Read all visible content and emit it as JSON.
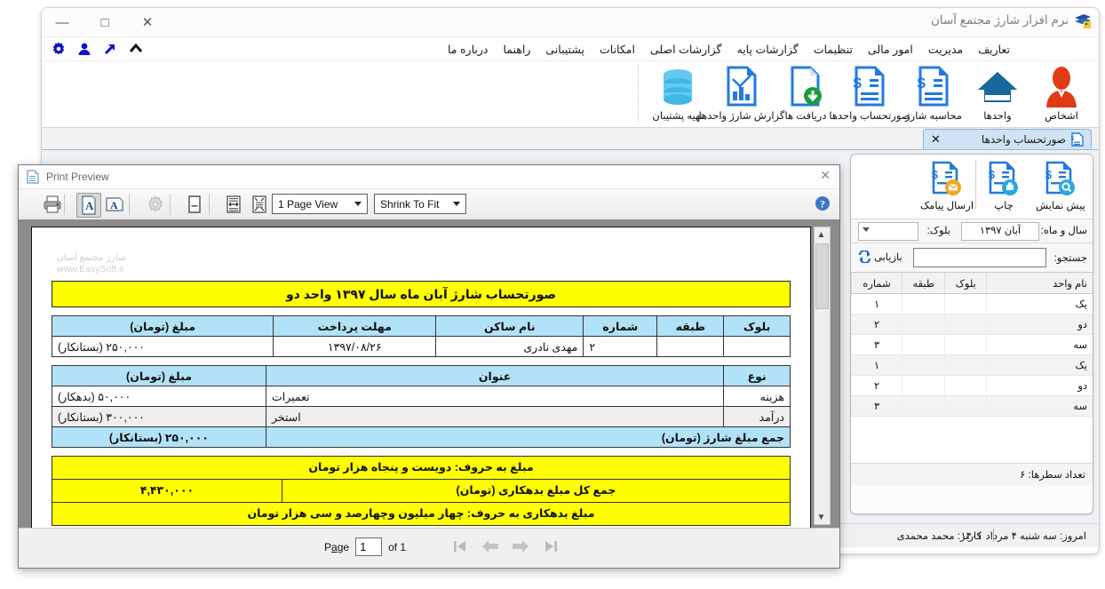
{
  "app": {
    "title": "نرم افزار شارژ مجتمع آسان",
    "window_controls": {
      "close": "✕",
      "maximize": "□",
      "minimize": "—"
    },
    "quick_icons": [
      "chevron-up-icon",
      "arrow-up-right-icon",
      "person-icon",
      "gear-icon"
    ],
    "menu": [
      "تعاریف",
      "مدیریت",
      "امور مالی",
      "تنظیمات",
      "گزارشات پایه",
      "گزارشات اصلی",
      "امکانات",
      "پشتیبانی",
      "راهنما",
      "درباره ما"
    ],
    "ribbon": [
      {
        "label": "اشخاص",
        "icon": "person-red-icon"
      },
      {
        "label": "واحدها",
        "icon": "house-icon"
      },
      {
        "label": "محاسبه شارژ",
        "icon": "invoice-icon"
      },
      {
        "label": "صورتحساب واحدها",
        "icon": "invoice-icon"
      },
      {
        "label": "دریافت ها",
        "icon": "document-download-icon"
      },
      {
        "label": "گزارش شارژ واحدها",
        "icon": "chart-document-icon"
      },
      {
        "label": "تهیه پشتیبان",
        "icon": "database-icon"
      }
    ],
    "tab": {
      "label": "صورتحساب واحدها",
      "close": "✕",
      "icon": "invoice-tab-icon"
    }
  },
  "panel": {
    "actions": [
      {
        "label": "پیش نمایش",
        "icon": "preview-icon"
      },
      {
        "label": "چاپ",
        "icon": "print-icon"
      },
      {
        "label": "ارسال پیامک",
        "icon": "sms-icon"
      }
    ],
    "filters": {
      "period_label": "سال و ماه:",
      "period_value": "آبان ۱۳۹۷",
      "block_label": "بلوک:",
      "block_value": ""
    },
    "search": {
      "label": "جستجو:",
      "value": "",
      "refresh_label": "بازیابی",
      "refresh_icon": "refresh-icon"
    },
    "grid": {
      "headers": [
        "نام واحد",
        "بلوک",
        "طبقه",
        "شماره"
      ],
      "rows": [
        {
          "name": "یک",
          "block": "",
          "floor": "",
          "number": "۱"
        },
        {
          "name": "دو",
          "block": "",
          "floor": "",
          "number": "۲"
        },
        {
          "name": "سه",
          "block": "",
          "floor": "",
          "number": "۳"
        },
        {
          "name": "یک",
          "block": "",
          "floor": "",
          "number": "۱"
        },
        {
          "name": "دو",
          "block": "",
          "floor": "",
          "number": "۲"
        },
        {
          "name": "سه",
          "block": "",
          "floor": "",
          "number": "۳"
        }
      ]
    },
    "rowcount": "تعداد سطرها:   ۶"
  },
  "statusbar": {
    "today": "امروز: سه شنبه ۴ مرداد ۱۴۰۱",
    "user": "کاربر: محمد محمدی"
  },
  "print_preview": {
    "title": "Print Preview",
    "close": "✕",
    "toolbar": {
      "buttons": [
        {
          "name": "print-button",
          "icon": "printer-icon"
        },
        {
          "name": "portrait-button",
          "icon": "page-portrait-icon"
        },
        {
          "name": "landscape-button",
          "icon": "page-landscape-icon"
        },
        {
          "name": "page-setup-button",
          "icon": "gear-icon"
        },
        {
          "name": "margins-button",
          "icon": "margins-icon"
        },
        {
          "name": "page-width-button",
          "icon": "page-width-icon"
        },
        {
          "name": "whole-page-button",
          "icon": "whole-page-icon"
        }
      ],
      "page_view_select": "1 Page View",
      "zoom_select": "Shrink To Fit",
      "help_icon": "help-icon"
    },
    "footer": {
      "page_label_pre": "P",
      "page_label_underline": "a",
      "page_label_post": "ge",
      "page_value": "1",
      "of_label": "of 1",
      "nav": [
        "first-page-icon",
        "previous-page-icon",
        "next-page-icon",
        "last-page-icon"
      ]
    }
  },
  "document": {
    "watermark_line1": "شارژ مجتمع آسان",
    "watermark_line2": "www.EasySoft.ir",
    "title": "صورتحساب شارژ آبان ماه سال ۱۳۹۷ واحد دو",
    "info_table": {
      "headers": [
        "بلوک",
        "طبقه",
        "شماره",
        "نام ساکن",
        "مهلت پرداخت",
        "مبلغ (تومان)"
      ],
      "row": {
        "block": "",
        "floor": "",
        "number": "۲",
        "resident": "مهدی نادری",
        "due_date": "۱۳۹۷/۰۸/۲۶",
        "amount": "۲۵۰,۰۰۰ (بستانکار)"
      }
    },
    "detail_table": {
      "headers": [
        "نوع",
        "عنوان",
        "مبلغ (تومان)"
      ],
      "rows": [
        {
          "type": "هزینه",
          "title": "تعمیرات",
          "amount": "۵۰,۰۰۰ (بدهکار)"
        },
        {
          "type": "درآمد",
          "title": "استخر",
          "amount": "۳۰۰,۰۰۰ (بستانکار)"
        }
      ],
      "total_label": "جمع مبلغ شارژ (تومان)",
      "total_amount": "۲۵۰,۰۰۰ (بستانکار)"
    },
    "summary": {
      "amount_in_words": "مبلغ به حروف: دویست و پنجاه هزار تومان",
      "debt_total_label": "جمع کل مبلغ بدهکاری (تومان)",
      "debt_total_amount": "۴,۴۳۰,۰۰۰",
      "debt_in_words": "مبلغ بدهکاری به حروف: چهار میلیون وچهارصد و سی هزار تومان"
    }
  },
  "colors": {
    "yellow": "#ffff00",
    "table_header_blue": "#b2e2f8",
    "ribbon_blue": "#1565d8",
    "person_red": "#e03a16"
  }
}
